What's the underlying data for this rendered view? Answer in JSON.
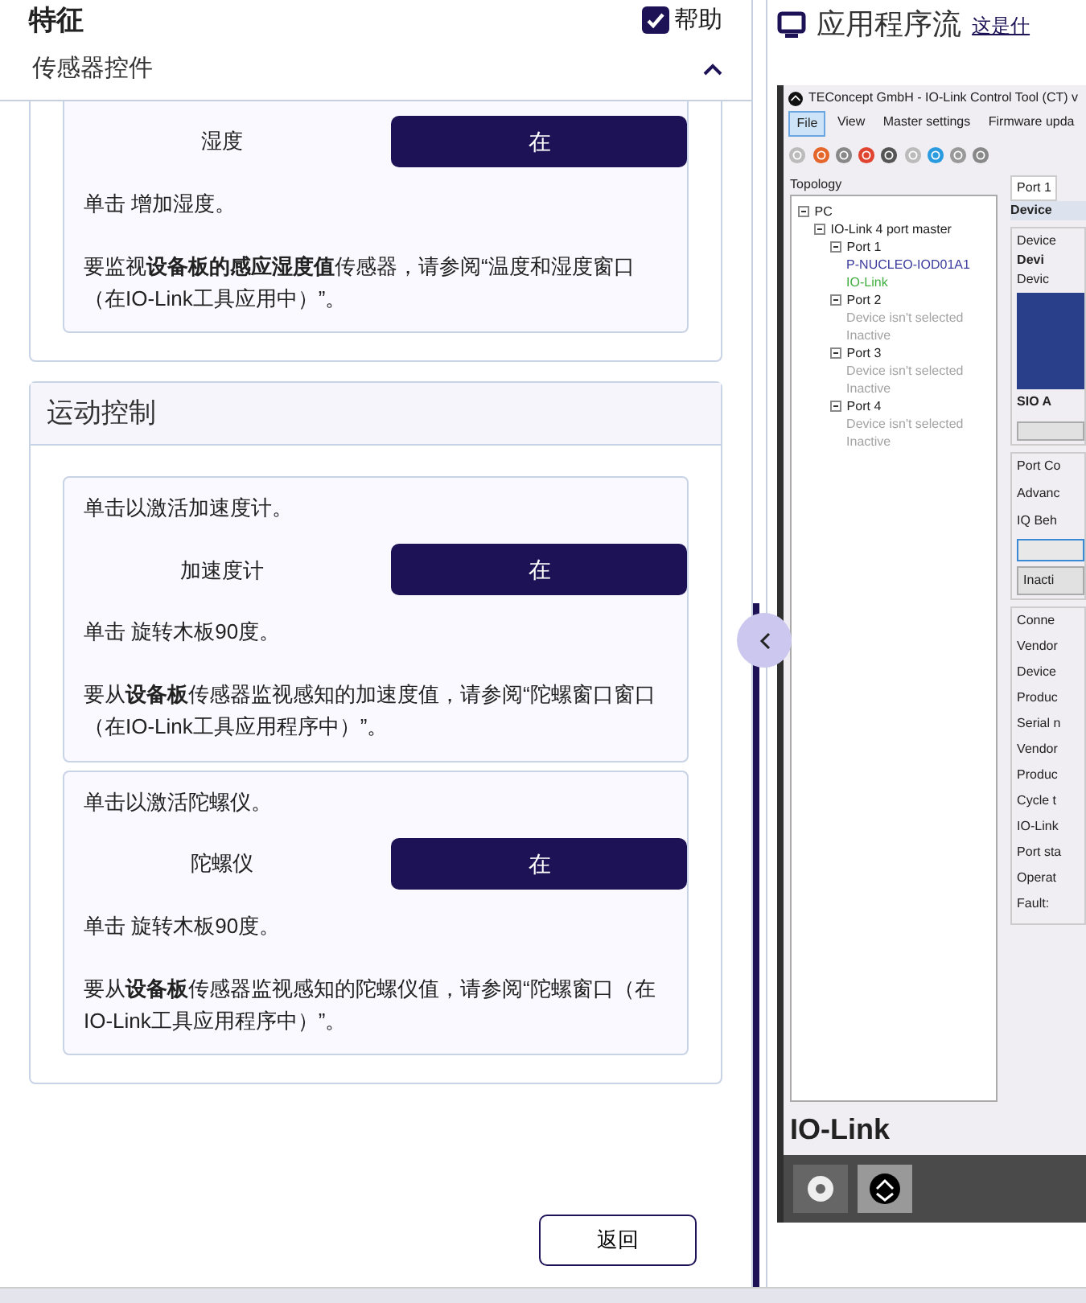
{
  "features_panel": {
    "title": "特征",
    "help": {
      "label": "帮助",
      "checked": true
    },
    "accordion": {
      "title": "传感器控件",
      "expanded": true
    },
    "sections": [
      {
        "controls": [
          {
            "label": "湿度",
            "button": "在",
            "hint": "单击 增加湿度。",
            "note": "要监视**设备板的感应湿度值**传感器，请参阅“温度和湿度窗口（在IO-Link工具应用中）”。"
          }
        ]
      },
      {
        "title": "运动控制",
        "controls": [
          {
            "intro": "单击以激活加速度计。",
            "label": "加速度计",
            "button": "在",
            "hint": "单击 旋转木板90度。",
            "note": "要从**设备板**传感器监视感知的加速度值，请参阅“陀螺窗口窗口（在IO-Link工具应用程序中）”。"
          },
          {
            "intro": "单击以激活陀螺仪。",
            "label": "陀螺仪",
            "button": "在",
            "hint": "单击 旋转木板90度。",
            "note": "要从**设备板**传感器监视感知的陀螺仪值，请参阅“陀螺窗口（在IO-Link工具应用程序中）”。"
          }
        ]
      }
    ],
    "back_button": "返回"
  },
  "app_flow": {
    "title": "应用程序流",
    "help_link": "这是什",
    "window": {
      "title": "TEConcept GmbH - IO-Link Control Tool (CT) v",
      "menu": [
        {
          "label": "File",
          "selected": true
        },
        {
          "label": "View",
          "selected": false
        },
        {
          "label": "Master settings",
          "selected": false
        },
        {
          "label": "Firmware upda",
          "selected": false
        }
      ],
      "topology": {
        "title": "Topology",
        "tree": [
          {
            "label": "PC",
            "children": [
              {
                "label": "IO-Link 4 port master",
                "children": [
                  {
                    "label": "Port 1",
                    "children": [
                      {
                        "label": "P-NUCLEO-IOD01A1",
                        "color": "#3b3b9e"
                      },
                      {
                        "label": "IO-Link",
                        "color": "#3fae3f"
                      }
                    ]
                  },
                  {
                    "label": "Port 2",
                    "children": [
                      {
                        "label": "Device isn't selected",
                        "color": "#a3a3a3"
                      },
                      {
                        "label": "Inactive",
                        "color": "#a3a3a3"
                      }
                    ]
                  },
                  {
                    "label": "Port 3",
                    "children": [
                      {
                        "label": "Device isn't selected",
                        "color": "#a3a3a3"
                      },
                      {
                        "label": "Inactive",
                        "color": "#a3a3a3"
                      }
                    ]
                  },
                  {
                    "label": "Port 4",
                    "children": [
                      {
                        "label": "Device isn't selected",
                        "color": "#a3a3a3"
                      },
                      {
                        "label": "Inactive",
                        "color": "#a3a3a3"
                      }
                    ]
                  }
                ]
              }
            ]
          }
        ]
      },
      "tab": "Port 1",
      "subtab": "Device",
      "device_legend": "Device",
      "device_name": "Devi",
      "image_legend": "Devic",
      "device_caption": "SIO A",
      "port_legend": "Port Co",
      "port_rows": [
        "Advanc",
        "IQ Beh"
      ],
      "port_button": "Inacti",
      "connection_legend": "Conne",
      "connection_fields": [
        "Vendor",
        "Device",
        "Produc",
        "Serial n",
        "Vendor",
        "Produc",
        "Cycle t",
        "IO-Link",
        "Port sta",
        "Operat",
        "Fault:"
      ],
      "logo_text": "IO-Link"
    }
  }
}
